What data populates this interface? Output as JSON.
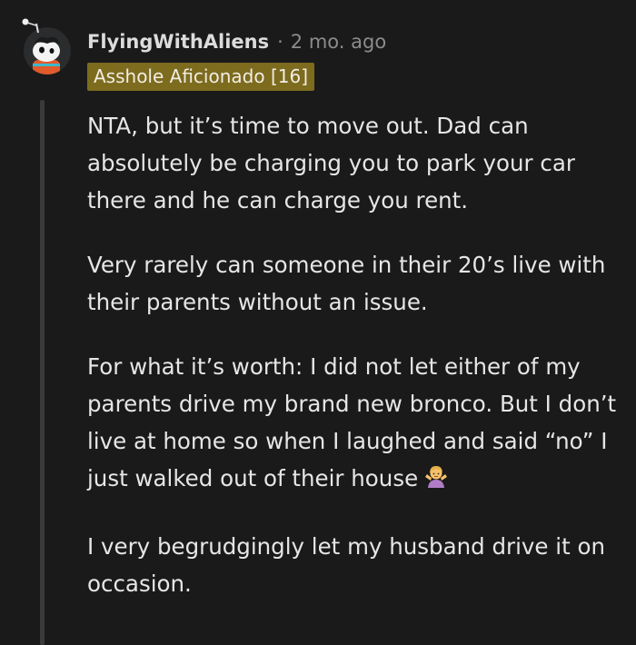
{
  "comment": {
    "username": "FlyingWithAliens",
    "separator": "·",
    "timestamp": "2 mo. ago",
    "flair": "Asshole Aficionado [16]",
    "avatar_icon": "snoo-avatar-icon",
    "paragraphs": [
      "NTA, but it’s time to move out. Dad can absolutely be charging you to park your car there and he can charge you rent.",
      "Very rarely can someone in their 20’s live with their parents without an issue.",
      "For what it’s worth: I did not let either of my parents drive my brand new bronco. But I don’t live at home so when I laughed and said “no” I just walked out of their house",
      "I very begrudgingly let my husband drive it on occasion."
    ],
    "emoji": "woman-shrugging-emoji",
    "colors": {
      "background": "#1a1a1b",
      "flair_bg": "#7d6b1e",
      "text": "#e6e6e6",
      "meta": "#8c8c8c"
    }
  }
}
